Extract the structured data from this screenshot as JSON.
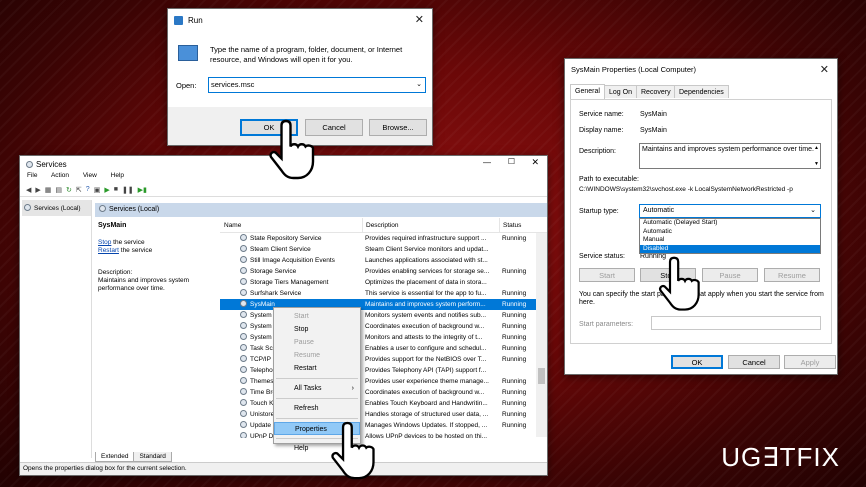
{
  "run": {
    "title": "Run",
    "description": "Type the name of a program, folder, document, or Internet resource, and Windows will open it for you.",
    "open_label": "Open:",
    "open_value": "services.msc",
    "ok": "OK",
    "cancel": "Cancel",
    "browse": "Browse..."
  },
  "services": {
    "title": "Services",
    "menu": [
      "File",
      "Action",
      "View",
      "Help"
    ],
    "tree_item": "Services (Local)",
    "header": "Services (Local)",
    "left_title": "SysMain",
    "stop_link": "Stop",
    "stop_rest": " the service",
    "restart_link": "Restart",
    "restart_rest": " the service",
    "desc_label": "Description:",
    "desc_text": "Maintains and improves system performance over time.",
    "col_name": "Name",
    "col_desc": "Description",
    "col_status": "Status",
    "rows": [
      {
        "name": "State Repository Service",
        "desc": "Provides required infrastructure support ...",
        "status": "Running"
      },
      {
        "name": "Steam Client Service",
        "desc": "Steam Client Service monitors and updat...",
        "status": ""
      },
      {
        "name": "Still Image Acquisition Events",
        "desc": "Launches applications associated with st...",
        "status": ""
      },
      {
        "name": "Storage Service",
        "desc": "Provides enabling services for storage se...",
        "status": "Running"
      },
      {
        "name": "Storage Tiers Management",
        "desc": "Optimizes the placement of data in stora...",
        "status": ""
      },
      {
        "name": "Surfshark Service",
        "desc": "This service is essential for the app to fu...",
        "status": "Running"
      },
      {
        "name": "SysMain",
        "desc": "Maintains and improves system perform...",
        "status": "Running"
      },
      {
        "name": "System Event",
        "desc": "Monitors system events and notifies sub...",
        "status": "Running"
      },
      {
        "name": "System Event",
        "desc": "Coordinates execution of background w...",
        "status": "Running"
      },
      {
        "name": "System Guard",
        "desc": "Monitors and attests to the integrity of t...",
        "status": "Running"
      },
      {
        "name": "Task Schedul",
        "desc": "Enables a user to configure and schedul...",
        "status": "Running"
      },
      {
        "name": "TCP/IP NetBI",
        "desc": "Provides support for the NetBIOS over T...",
        "status": "Running"
      },
      {
        "name": "Telephony",
        "desc": "Provides Telephony API (TAPI) support f...",
        "status": ""
      },
      {
        "name": "Themes",
        "desc": "Provides user experience theme manage...",
        "status": "Running"
      },
      {
        "name": "Time Broker",
        "desc": "Coordinates execution of background w...",
        "status": "Running"
      },
      {
        "name": "Touch Keybo",
        "desc": "Enables Touch Keyboard and Handwritin...",
        "status": "Running"
      },
      {
        "name": "UnistoreSvc_",
        "desc": "Handles storage of structured user data, ...",
        "status": "Running"
      },
      {
        "name": "Update Orche",
        "desc": "Manages Windows Updates. If stopped, ...",
        "status": "Running"
      },
      {
        "name": "UPnP Device",
        "desc": "Allows UPnP devices to be hosted on thi...",
        "status": ""
      }
    ],
    "tab_extended": "Extended",
    "tab_standard": "Standard",
    "statusbar": "Opens the properties dialog box for the current selection.",
    "context": {
      "start": "Start",
      "stop": "Stop",
      "pause": "Pause",
      "resume": "Resume",
      "restart": "Restart",
      "all_tasks": "All Tasks",
      "refresh": "Refresh",
      "properties": "Properties",
      "help": "Help"
    }
  },
  "props": {
    "title": "SysMain Properties (Local Computer)",
    "tabs": [
      "General",
      "Log On",
      "Recovery",
      "Dependencies"
    ],
    "service_name_label": "Service name:",
    "service_name": "SysMain",
    "display_name_label": "Display name:",
    "display_name": "SysMain",
    "description_label": "Description:",
    "description": "Maintains and improves system performance over time.",
    "path_label": "Path to executable:",
    "path": "C:\\WINDOWS\\system32\\svchost.exe -k LocalSystemNetworkRestricted -p",
    "startup_label": "Startup type:",
    "startup_value": "Automatic",
    "startup_options": [
      "Automatic (Delayed Start)",
      "Automatic",
      "Manual",
      "Disabled"
    ],
    "status_label": "Service status:",
    "status_value": "Running",
    "start": "Start",
    "stop": "Stop",
    "pause": "Pause",
    "resume": "Resume",
    "params_note": "You can specify the start parameters that apply when you start the service from here.",
    "params_label": "Start parameters:",
    "ok": "OK",
    "cancel": "Cancel",
    "apply": "Apply"
  },
  "watermark": "UG∃TFIX"
}
